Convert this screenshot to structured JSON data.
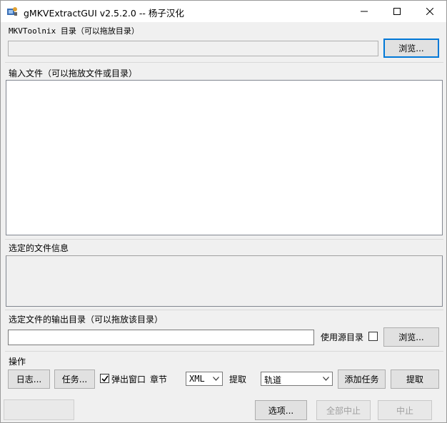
{
  "window": {
    "title": "gMKVExtractGUI v2.5.2.0 -- 杨子汉化"
  },
  "caption_buttons": {
    "minimize_icon": "minimize-icon",
    "maximize_icon": "maximize-icon",
    "close_icon": "close-icon"
  },
  "mkvtoolnix": {
    "label": "MKVToolnix 目录（可以拖放目录）",
    "path_value": "",
    "browse_label": "浏览..."
  },
  "input_files": {
    "label": "输入文件（可以拖放文件或目录）",
    "items": []
  },
  "file_info": {
    "label": "选定的文件信息",
    "text": ""
  },
  "output": {
    "label": "选定文件的输出目录（可以拖放该目录）",
    "path_value": "",
    "use_source_label": "使用源目录",
    "use_source_checked": false,
    "browse_label": "浏览..."
  },
  "actions": {
    "label": "操作",
    "log_label": "日志...",
    "jobs_label": "任务...",
    "popup_label": "弹出窗口",
    "popup_checked": true,
    "chapters_label": "章节",
    "chapter_format": "XML",
    "extract_label": "提取",
    "track_mode": "轨道",
    "add_job_label": "添加任务",
    "extract_button_label": "提取"
  },
  "statusbar": {
    "options_label": "选项...",
    "abort_all_label": "全部中止",
    "abort_label": "中止"
  },
  "colors": {
    "accent": "#0078d7",
    "window_bg": "#f0f0f0"
  }
}
